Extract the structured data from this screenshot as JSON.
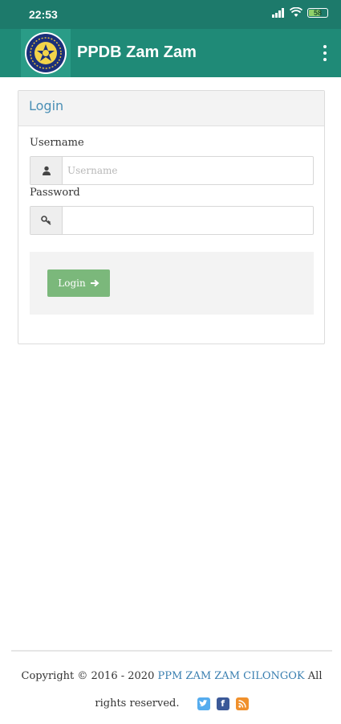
{
  "status_bar": {
    "time": "22:53",
    "battery": "58"
  },
  "app_bar": {
    "title": "PPDB Zam Zam"
  },
  "login_panel": {
    "title": "Login",
    "username_label": "Username",
    "username_placeholder": "Username",
    "username_value": "",
    "password_label": "Password",
    "password_value": "",
    "login_button": "Login"
  },
  "footer": {
    "prefix": "Copyright © 2016 - 2020 ",
    "org_link": "PPM ZAM ZAM CILONGOK",
    "suffix": " All rights reserved.",
    "social": [
      "twitter-icon",
      "facebook-icon",
      "rss-icon"
    ]
  },
  "colors": {
    "status_bar": "#1d7a6b",
    "app_bar": "#1f8a77",
    "panel_title": "#4a8fb5",
    "login_button": "#7bb87b",
    "link": "#3a7fb0",
    "twitter": "#55acee",
    "facebook": "#3b5998",
    "rss": "#f0902c"
  }
}
